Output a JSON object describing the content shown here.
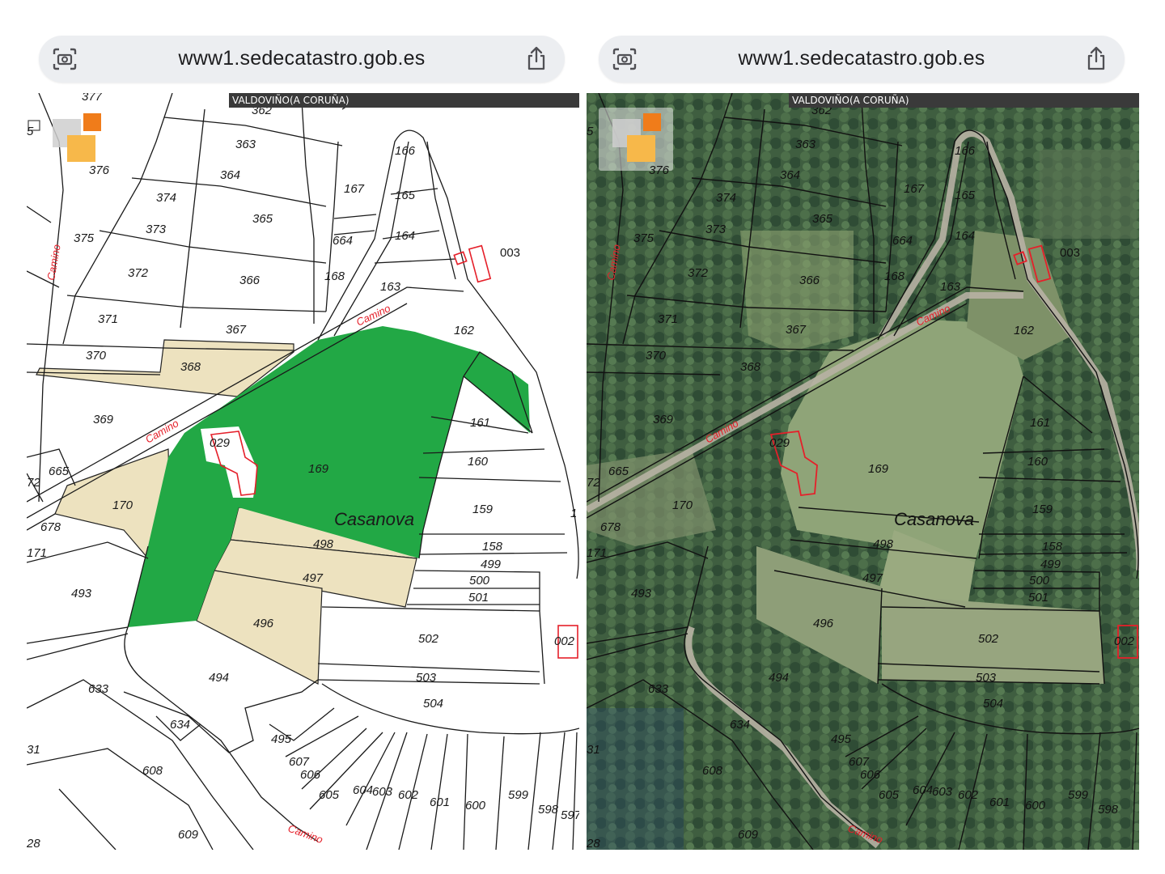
{
  "left_pane": {
    "url": "www1.sedecatastro.gob.es",
    "map_title": "VALDOVIÑO(A CORUÑA)",
    "view": "cadastral-map"
  },
  "right_pane": {
    "url": "www1.sedecatastro.gob.es",
    "map_title": "VALDOVIÑO(A CORUÑA)",
    "view": "orthophoto"
  },
  "icons": {
    "screenshot": "screenshot-capture-icon",
    "share": "share-icon",
    "layers": "layers-icon"
  },
  "place_name": "Casanova",
  "road_label": "Camino",
  "buildings": [
    "003",
    "029",
    "002"
  ],
  "colors": {
    "highlight_parcel": "#22a845",
    "adjacent_parcel": "#ede2bf",
    "building_outline": "#e5202a",
    "label_red": "#e5202a",
    "orange": "#f07c1a",
    "amber": "#f7b84a"
  },
  "parcel_labels": {
    "p377": "377",
    "p362": "362",
    "p363": "363",
    "p364": "364",
    "p365": "365",
    "p366": "366",
    "p367": "367",
    "p368": "368",
    "p369": "369",
    "p370": "370",
    "p371": "371",
    "p372": "372",
    "p373": "373",
    "p374": "374",
    "p375": "375",
    "p376": "376",
    "p167": "167",
    "p165": "165",
    "p166": "166",
    "p164": "164",
    "p664": "664",
    "p168": "168",
    "p163": "163",
    "p162": "162",
    "p161": "161",
    "p160": "160",
    "p159": "159",
    "p158": "158",
    "p499": "499",
    "p500": "500",
    "p501": "501",
    "p502": "502",
    "p503": "503",
    "p504": "504",
    "p169": "169",
    "p170": "170",
    "p498": "498",
    "p497": "497",
    "p496": "496",
    "p494": "494",
    "p493": "493",
    "p495": "495",
    "p665": "665",
    "p678": "678",
    "p171": "171",
    "p633": "633",
    "p634": "634",
    "p608": "608",
    "p609": "609",
    "p607": "607",
    "p606": "606",
    "p605": "605",
    "p604": "604",
    "p603": "603",
    "p602": "602",
    "p601": "601",
    "p600": "600",
    "p599": "599",
    "p598": "598",
    "p597": "597",
    "p72": "72",
    "p31": "31",
    "p28": "28",
    "p5": "5",
    "p1": "1"
  }
}
